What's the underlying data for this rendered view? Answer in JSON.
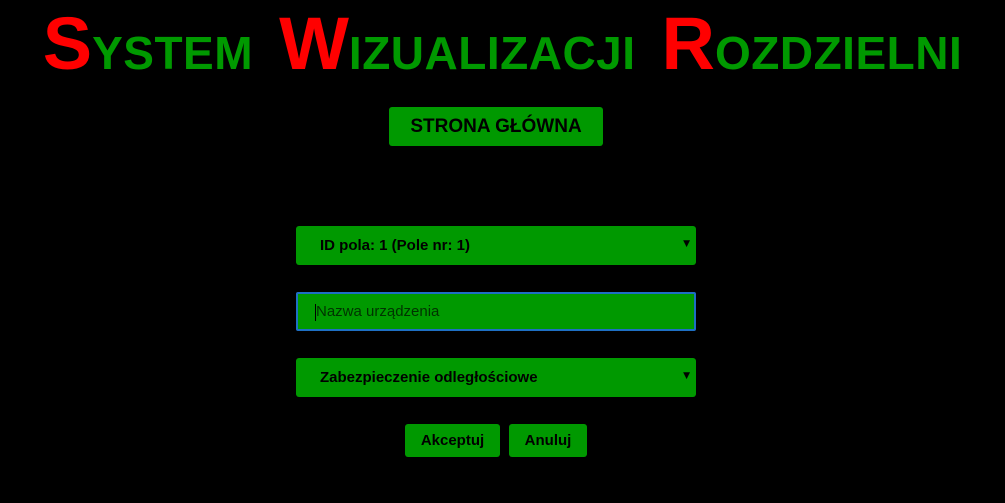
{
  "header": {
    "title_words": [
      {
        "cap": "S",
        "rest": "YSTEM"
      },
      {
        "cap": "W",
        "rest": "IZUALIZACJI"
      },
      {
        "cap": "R",
        "rest": "OZDZIELNI"
      }
    ]
  },
  "nav": {
    "home_label": "STRONA GŁÓWNA"
  },
  "form": {
    "field_select": {
      "value": "ID pola: 1 (Pole nr: 1)",
      "arrow": "▼"
    },
    "device_name": {
      "placeholder": "Nazwa urządzenia",
      "value": ""
    },
    "protection_select": {
      "value": "Zabezpieczenie odległościowe",
      "arrow": "▼"
    },
    "accept_label": "Akceptuj",
    "cancel_label": "Anuluj"
  },
  "colors": {
    "background": "#000000",
    "accent_green": "#009900",
    "title_red": "#ff0000",
    "focus_border": "#1e6fc4"
  }
}
